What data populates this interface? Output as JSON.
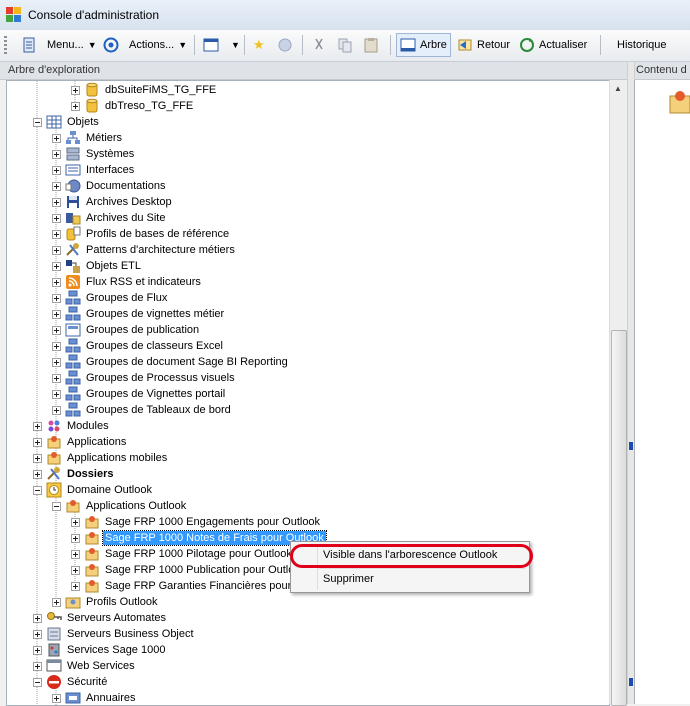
{
  "window": {
    "title": "Console d'administration"
  },
  "toolbar": {
    "menu_label": "Menu...",
    "actions_label": "Actions...",
    "tree_label": "Arbre",
    "back_label": "Retour",
    "refresh_label": "Actualiser",
    "history_label": "Historique"
  },
  "panes": {
    "tree_header": "Arbre d'exploration",
    "content_header": "Contenu d"
  },
  "tree": {
    "n0": "dbSuiteFiMS_TG_FFE",
    "n1": "dbTreso_TG_FFE",
    "n2": "Objets",
    "n3": "Métiers",
    "n4": "Systèmes",
    "n5": "Interfaces",
    "n6": "Documentations",
    "n7": "Archives Desktop",
    "n8": "Archives du Site",
    "n9": "Profils de bases de référence",
    "n10": "Patterns d'architecture métiers",
    "n11": "Objets ETL",
    "n12": "Flux RSS et indicateurs",
    "n13": "Groupes de Flux",
    "n14": "Groupes de vignettes métier",
    "n15": "Groupes de publication",
    "n16": "Groupes de classeurs Excel",
    "n17": "Groupes de document Sage BI Reporting",
    "n18": "Groupes de Processus visuels",
    "n19": "Groupes de Vignettes portail",
    "n20": "Groupes de Tableaux de bord",
    "n21": "Modules",
    "n22": "Applications",
    "n23": "Applications mobiles",
    "n24": "Dossiers",
    "n25": "Domaine Outlook",
    "n26": "Applications Outlook",
    "n27": "Sage FRP 1000 Engagements pour Outlook",
    "n28": "Sage FRP 1000 Notes de Frais pour Outlook",
    "n29": "Sage FRP 1000 Pilotage pour Outlook",
    "n30": "Sage FRP 1000 Publication pour Outlo",
    "n31": "Sage FRP Garanties Financières pour (",
    "n32": "Profils Outlook",
    "n33": "Serveurs Automates",
    "n34": "Serveurs Business Object",
    "n35": "Services Sage 1000",
    "n36": "Web Services",
    "n37": "Sécurité",
    "n38": "Annuaires"
  },
  "context_menu": {
    "visible_label": "Visible dans l'arborescence Outlook",
    "delete_label": "Supprimer"
  }
}
